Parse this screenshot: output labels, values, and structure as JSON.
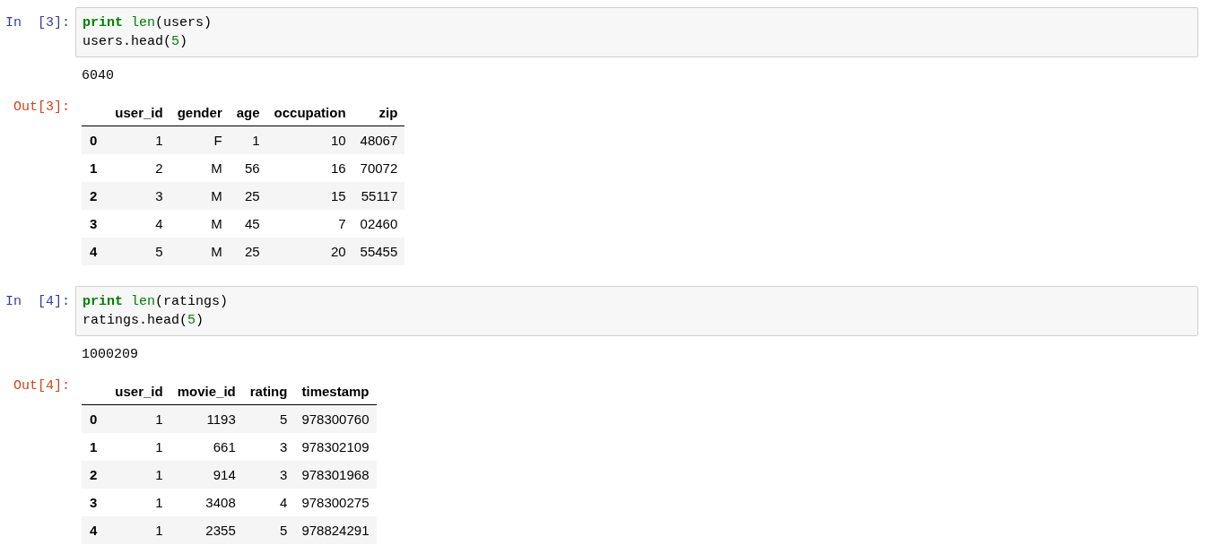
{
  "cells": [
    {
      "in_prompt": "In [3]:",
      "code_lines": [
        [
          {
            "text": "print",
            "kind": "keyword"
          },
          {
            "text": " len",
            "kind": "builtin"
          },
          {
            "text": "(users)",
            "kind": "plain"
          }
        ],
        [
          {
            "text": "users.head(",
            "kind": "plain"
          },
          {
            "text": "5",
            "kind": "number"
          },
          {
            "text": ")",
            "kind": "plain"
          }
        ]
      ],
      "stream_output": "6040",
      "out_prompt": "Out[3]:",
      "table": {
        "columns": [
          "user_id",
          "gender",
          "age",
          "occupation",
          "zip"
        ],
        "rows": [
          {
            "index": "0",
            "cells": [
              "1",
              "F",
              "1",
              "10",
              "48067"
            ]
          },
          {
            "index": "1",
            "cells": [
              "2",
              "M",
              "56",
              "16",
              "70072"
            ]
          },
          {
            "index": "2",
            "cells": [
              "3",
              "M",
              "25",
              "15",
              "55117"
            ]
          },
          {
            "index": "3",
            "cells": [
              "4",
              "M",
              "45",
              "7",
              "02460"
            ]
          },
          {
            "index": "4",
            "cells": [
              "5",
              "M",
              "25",
              "20",
              "55455"
            ]
          }
        ]
      }
    },
    {
      "in_prompt": "In [4]:",
      "code_lines": [
        [
          {
            "text": "print",
            "kind": "keyword"
          },
          {
            "text": " len",
            "kind": "builtin"
          },
          {
            "text": "(ratings)",
            "kind": "plain"
          }
        ],
        [
          {
            "text": "ratings.head(",
            "kind": "plain"
          },
          {
            "text": "5",
            "kind": "number"
          },
          {
            "text": ")",
            "kind": "plain"
          }
        ]
      ],
      "stream_output": "1000209",
      "out_prompt": "Out[4]:",
      "table": {
        "columns": [
          "user_id",
          "movie_id",
          "rating",
          "timestamp"
        ],
        "rows": [
          {
            "index": "0",
            "cells": [
              "1",
              "1193",
              "5",
              "978300760"
            ]
          },
          {
            "index": "1",
            "cells": [
              "1",
              "661",
              "3",
              "978302109"
            ]
          },
          {
            "index": "2",
            "cells": [
              "1",
              "914",
              "3",
              "978301968"
            ]
          },
          {
            "index": "3",
            "cells": [
              "1",
              "3408",
              "4",
              "978300275"
            ]
          },
          {
            "index": "4",
            "cells": [
              "1",
              "2355",
              "5",
              "978824291"
            ]
          }
        ]
      }
    }
  ]
}
